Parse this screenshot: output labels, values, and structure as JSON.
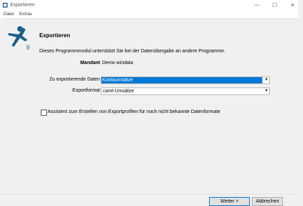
{
  "window": {
    "title": "Exportieren"
  },
  "menu": {
    "items": [
      "Datei",
      "Extras"
    ]
  },
  "header": {
    "heading": "Exportieren",
    "logo_badge": "9",
    "description": "Dieses Programmmodul unterstützt Sie bei der Datenübergabe an andere Programme."
  },
  "form": {
    "mandant_label": "Mandant",
    "mandant_value": "Demo windata",
    "data_label": "Zu exportierende Daten",
    "data_value": "Kontoumsätze",
    "format_label": "Exportformat",
    "format_value": "camt-Umsätze"
  },
  "assistant": {
    "label": "Assistent zum Erstellen von Exportprofilen für noch nicht bekannte Datenformate",
    "checked": false
  },
  "buttons": {
    "next": "Weiter >",
    "cancel": "Abbrechen"
  },
  "colors": {
    "accent": "#0078d7",
    "logo": "#1b5f8c"
  }
}
